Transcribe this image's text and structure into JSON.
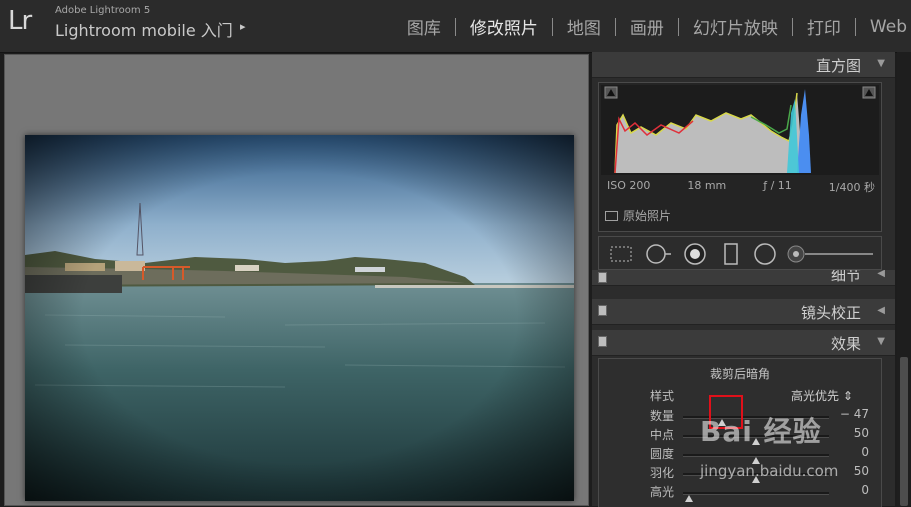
{
  "app": {
    "logo": "Lr",
    "product": "Adobe Lightroom 5",
    "title": "Lightroom mobile 入门",
    "title_arrow": "▸"
  },
  "modules": [
    "图库",
    "修改照片",
    "地图",
    "画册",
    "幻灯片放映",
    "打印",
    "Web"
  ],
  "active_module": "修改照片",
  "panels": {
    "histogram": {
      "title": "直方图",
      "exif": {
        "iso": "ISO 200",
        "focal": "18 mm",
        "aperture": "ƒ / 11",
        "shutter": "1/400 秒"
      },
      "original_photo": "原始照片"
    },
    "detail": {
      "title": "细节"
    },
    "lens": {
      "title": "镜头校正"
    },
    "effects": {
      "title": "效果",
      "post_crop_vignette": {
        "title": "裁剪后暗角",
        "style_label": "样式",
        "style_value": "高光优先",
        "sliders": [
          {
            "label": "数量",
            "value": "− 47",
            "level": -0.47
          },
          {
            "label": "中点",
            "value": "50",
            "level": 0.5
          },
          {
            "label": "圆度",
            "value": "0",
            "level": 0
          },
          {
            "label": "羽化",
            "value": "50",
            "level": 0.5
          },
          {
            "label": "高光",
            "value": "0",
            "level": 0
          }
        ]
      }
    }
  },
  "watermark": {
    "brand": "Bai 经验",
    "url": "jingyan.baidu.com"
  },
  "icons": [
    "crop-overlay-icon",
    "spot-removal-icon",
    "redeye-icon",
    "graduated-filter-icon",
    "radial-filter-icon",
    "adjustment-brush-icon"
  ]
}
